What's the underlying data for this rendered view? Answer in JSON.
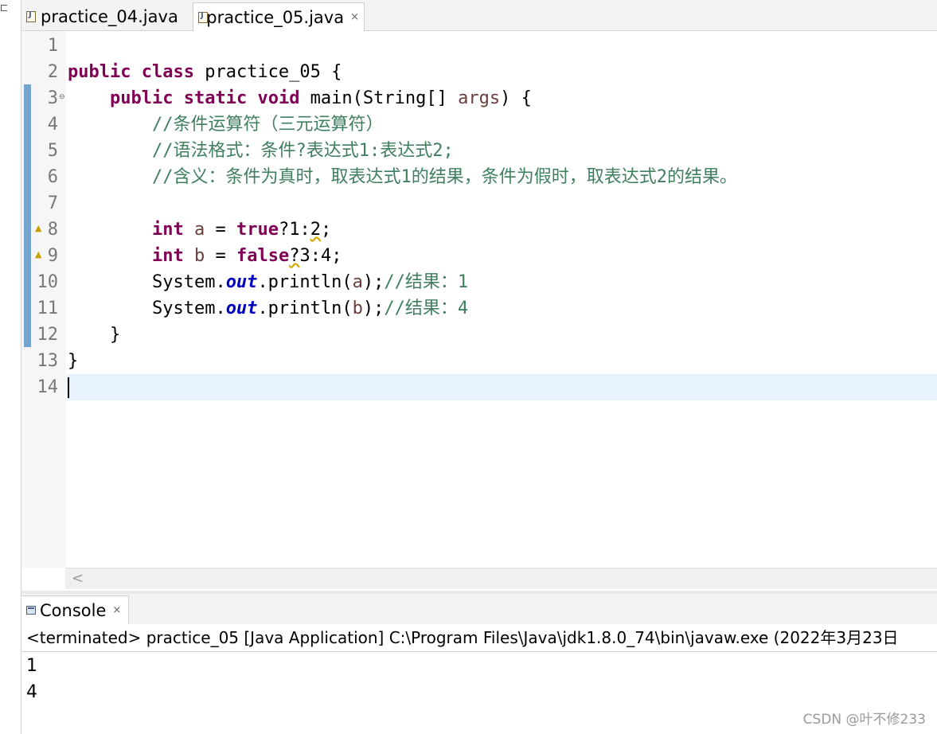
{
  "editor": {
    "tabs": [
      {
        "label": "practice_04.java",
        "active": false
      },
      {
        "label": "practice_05.java",
        "active": true,
        "close": "×"
      }
    ],
    "line_numbers": [
      "1",
      "2",
      "3",
      "4",
      "5",
      "6",
      "7",
      "8",
      "9",
      "10",
      "11",
      "12",
      "13",
      "14"
    ],
    "fold_marker": "⊖",
    "code": {
      "l2": {
        "kw1": "public",
        "kw2": "class",
        "rest": " practice_05 {"
      },
      "l3": {
        "indent": "    ",
        "kw1": "public",
        "kw2": "static",
        "kw3": "void",
        "mid": " main(String[] ",
        "var": "args",
        "end": ") {"
      },
      "l4": {
        "comment": "//条件运算符（三元运算符）"
      },
      "l5": {
        "comment": "//语法格式：条件?表达式1:表达式2;"
      },
      "l6": {
        "comment": "//含义：条件为真时，取表达式1的结果，条件为假时，取表达式2的结果。"
      },
      "l8": {
        "kw": "int",
        "a1": " ",
        "var": "a",
        "a2": " = ",
        "lit": "true",
        "expr": "?1:",
        "warn": "2",
        "end": ";"
      },
      "l9": {
        "kw": "int",
        "a1": " ",
        "var": "b",
        "a2": " = ",
        "lit": "false",
        "warn": "?",
        "expr": "3:4;"
      },
      "l10": {
        "pre": "System.",
        "fld": "out",
        "mid": ".println(",
        "var": "a",
        "end": ");",
        "comment": "//结果：1"
      },
      "l11": {
        "pre": "System.",
        "fld": "out",
        "mid": ".println(",
        "var": "b",
        "end": ");",
        "comment": "//结果：4"
      },
      "l12": {
        "text": "}"
      },
      "l13": {
        "text": "}"
      }
    }
  },
  "hscroll": {
    "left_arrow": "<"
  },
  "console": {
    "tab_label": "Console",
    "tab_close": "×",
    "status": "<terminated> practice_05 [Java Application] C:\\Program Files\\Java\\jdk1.8.0_74\\bin\\javaw.exe (2022年3月23日",
    "output": [
      "1",
      "4"
    ]
  },
  "watermark": "CSDN @叶不修233",
  "colors": {
    "keyword": "#7f0055",
    "comment": "#3f7f5f",
    "field": "#0000c0",
    "local_var": "#6a3e3e",
    "current_line": "#e8f2fe",
    "change_bar": "#73a5cf"
  }
}
